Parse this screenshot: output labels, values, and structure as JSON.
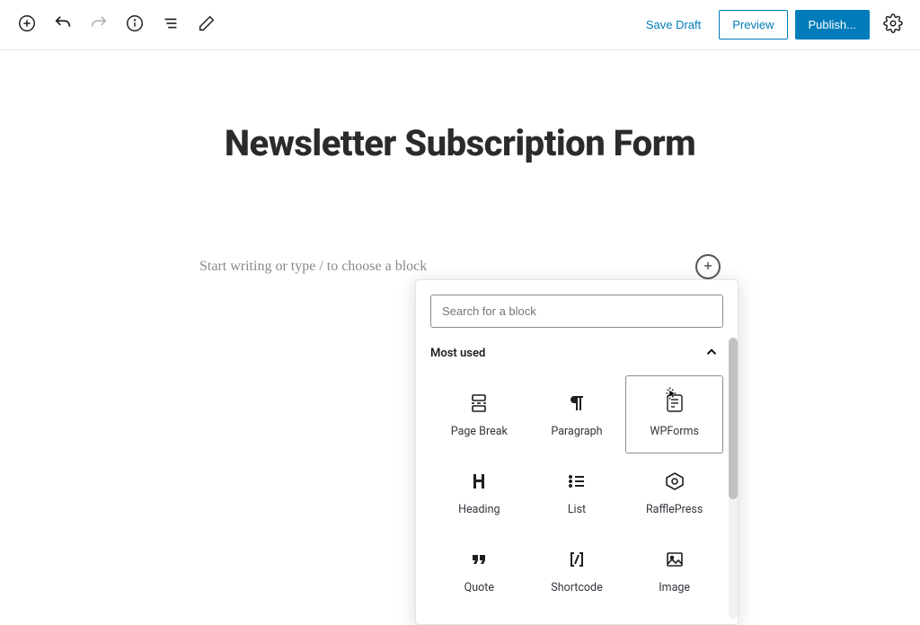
{
  "toolbar": {
    "save_draft": "Save Draft",
    "preview": "Preview",
    "publish": "Publish..."
  },
  "page": {
    "title": "Newsletter Subscription Form",
    "placeholder": "Start writing or type / to choose a block"
  },
  "block_picker": {
    "search_placeholder": "Search for a block",
    "section_title": "Most used",
    "blocks": [
      {
        "label": "Page Break",
        "icon": "pagebreak"
      },
      {
        "label": "Paragraph",
        "icon": "paragraph"
      },
      {
        "label": "WPForms",
        "icon": "wpforms",
        "selected": true
      },
      {
        "label": "Heading",
        "icon": "heading"
      },
      {
        "label": "List",
        "icon": "list"
      },
      {
        "label": "RafflePress",
        "icon": "rafflepress"
      },
      {
        "label": "Quote",
        "icon": "quote"
      },
      {
        "label": "Shortcode",
        "icon": "shortcode"
      },
      {
        "label": "Image",
        "icon": "image"
      }
    ]
  }
}
